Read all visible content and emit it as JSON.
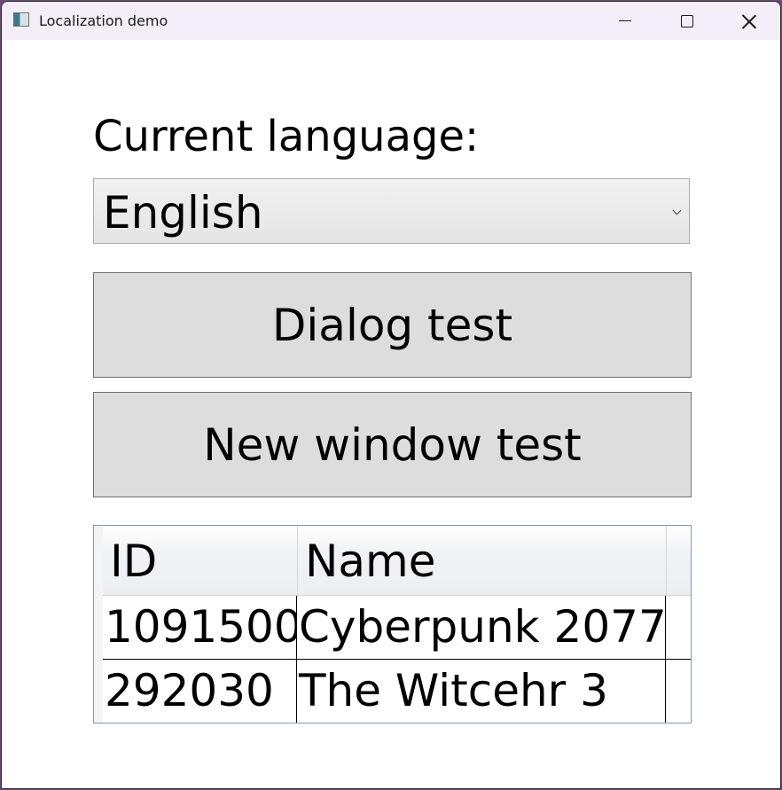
{
  "window": {
    "title": "Localization demo",
    "icon": "app-window-icon",
    "controls": {
      "minimize": "minimize-icon",
      "maximize": "maximize-icon",
      "close": "close-icon"
    }
  },
  "language": {
    "label": "Current language:",
    "selected": "English"
  },
  "buttons": {
    "dialog_test": "Dialog test",
    "new_window_test": "New window test"
  },
  "grid": {
    "columns": [
      "ID",
      "Name"
    ],
    "rows": [
      {
        "id": "1091500",
        "name": "Cyberpunk 2077"
      },
      {
        "id": "292030",
        "name": "The Witcehr 3"
      }
    ]
  }
}
